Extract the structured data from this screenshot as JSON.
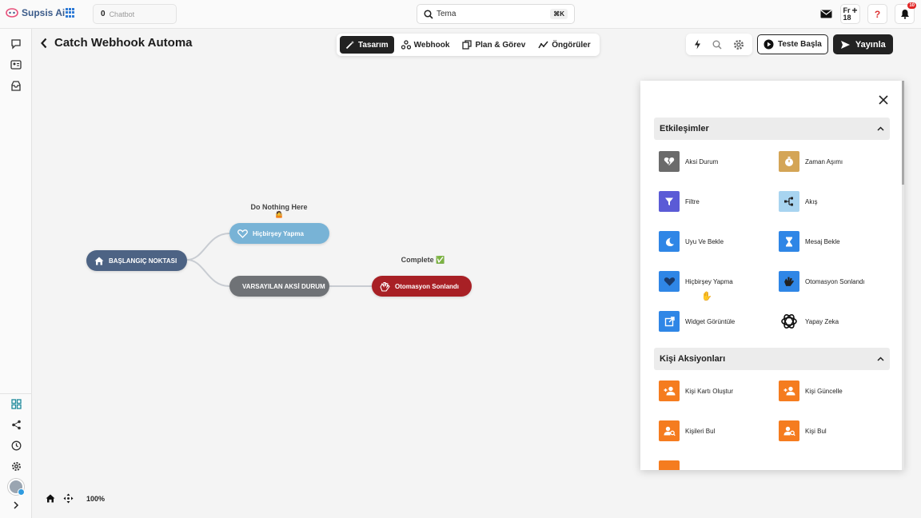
{
  "app": {
    "logo_text": "Supsis Ai",
    "chatbot_count": "0",
    "chatbot_label": "Chatbot",
    "search_value": "Tema",
    "search_shortcut": "⌘K",
    "date_line1": "Fr",
    "date_line2": "18",
    "notification_count": "10"
  },
  "page": {
    "title": "Catch Webhook Automa"
  },
  "tabs": [
    {
      "label": "Tasarım",
      "active": true
    },
    {
      "label": "Webhook",
      "active": false
    },
    {
      "label": "Plan & Görev",
      "active": false
    },
    {
      "label": "Öngörüler",
      "active": false
    }
  ],
  "actions": {
    "test_label": "Teste Başla",
    "publish_label": "Yayınla"
  },
  "canvas": {
    "zoom": "100%",
    "nodes": {
      "start": "BAŞLANGIÇ NOKTASI",
      "nothing": "Hiçbirşey Yapma",
      "default": "VARSAYILAN AKSİ DURUM",
      "end": "Otomasyon Sonlandı"
    },
    "labels": {
      "do_nothing": "Do Nothing Here",
      "do_nothing_emoji": "🤷",
      "complete": "Complete ✅"
    }
  },
  "panel": {
    "sections": [
      {
        "title": "Etkileşimler",
        "items": [
          {
            "label": "Aksi Durum",
            "icon": "broken-heart-icon",
            "color": "#6b6b6b"
          },
          {
            "label": "Zaman Aşımı",
            "icon": "stopwatch-icon",
            "color": "#d4a556"
          },
          {
            "label": "Filtre",
            "icon": "filter-icon",
            "color": "#5b5bd6"
          },
          {
            "label": "Akış",
            "icon": "flow-icon",
            "color": "#a8d4f0"
          },
          {
            "label": "Uyu Ve Bekle",
            "icon": "moon-icon",
            "color": "#2f86e6"
          },
          {
            "label": "Mesaj Bekle",
            "icon": "hourglass-icon",
            "color": "#2f86e6"
          },
          {
            "label": "Hiçbirşey Yapma",
            "icon": "heart-outline-icon",
            "color": "#2f86e6"
          },
          {
            "label": "Otomasyon Sonlandı",
            "icon": "clap-icon",
            "color": "#2f86e6"
          },
          {
            "label": "Widget Görüntüle",
            "icon": "external-link-icon",
            "color": "#2f86e6"
          },
          {
            "label": "Yapay Zeka",
            "icon": "openai-icon",
            "color": "#ffffff"
          }
        ]
      },
      {
        "title": "Kişi Aksiyonları",
        "items": [
          {
            "label": "Kişi Kartı Oluştur",
            "icon": "add-person-icon",
            "color": "#f57c1f"
          },
          {
            "label": "Kişi Güncelle",
            "icon": "add-person-icon",
            "color": "#f57c1f"
          },
          {
            "label": "Kişileri Bul",
            "icon": "search-person-icon",
            "color": "#f57c1f"
          },
          {
            "label": "Kişi Bul",
            "icon": "search-person-icon",
            "color": "#f57c1f"
          }
        ]
      }
    ]
  }
}
